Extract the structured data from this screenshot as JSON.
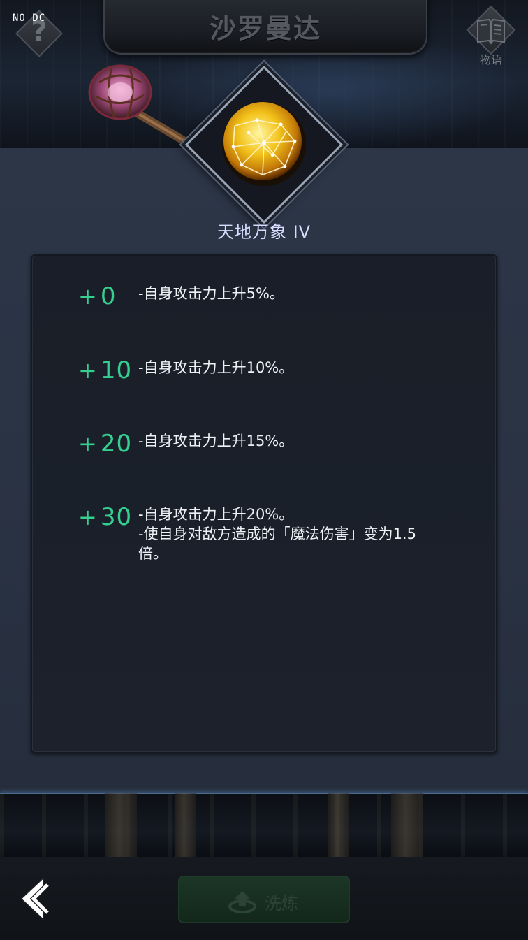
{
  "header": {
    "title": "沙罗曼达",
    "debug_label": "NO DC"
  },
  "help": {
    "glyph": "?"
  },
  "story": {
    "label": "物语"
  },
  "rune": {
    "name": "天地万象 IV"
  },
  "levels": [
    {
      "tag": "0",
      "lines": [
        "-自身攻击力上升5%。"
      ]
    },
    {
      "tag": "10",
      "lines": [
        "-自身攻击力上升10%。"
      ]
    },
    {
      "tag": "20",
      "lines": [
        "-自身攻击力上升15%。"
      ]
    },
    {
      "tag": "30",
      "lines": [
        "-自身攻击力上升20%。",
        "-使自身对敌方造成的「魔法伤害」变为1.5",
        "倍。"
      ]
    }
  ],
  "refine": {
    "label": "洗炼"
  },
  "colors": {
    "level_accent": "#35d08f",
    "rune_name": "#d8dcff",
    "panel_bg": "#1b202a"
  },
  "icons": [
    "help-icon",
    "book-icon",
    "rune-orb-icon",
    "staff-icon",
    "refine-upload-icon",
    "back-arrow-icon"
  ]
}
